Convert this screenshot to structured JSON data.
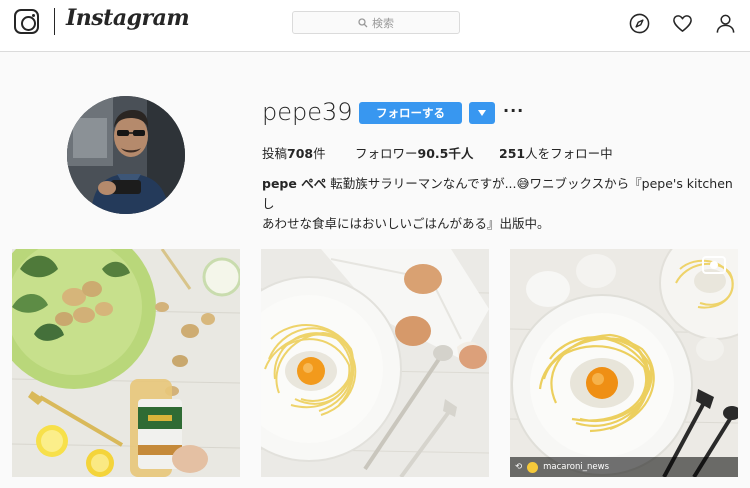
{
  "header": {
    "wordmark": "Instagram",
    "search_placeholder": "検索",
    "icons": [
      "instagram-logo-icon",
      "search-icon",
      "compass-icon",
      "heart-icon",
      "person-icon"
    ]
  },
  "profile": {
    "username": "pepe39",
    "follow_label": "フォローする",
    "more_label": "···",
    "stats": {
      "posts_prefix": "投稿",
      "posts_count": "708",
      "posts_suffix": "件",
      "followers_prefix": "フォロワー",
      "followers_count": "90.5千人",
      "following_count": "251",
      "following_suffix": "人をフォロー中"
    },
    "bio": {
      "name": "pepe ぺぺ",
      "line1": "転勤族サラリーマンなんですが...😅ワニブックスから『pepe's kitchen し",
      "line2": "あわせな食卓にはおいしいごはんがある』出版中。"
    }
  },
  "posts": [
    {
      "label": "post-1"
    },
    {
      "label": "post-2"
    },
    {
      "label": "post-3",
      "credit": "macaroni_news",
      "media_icon": "video-icon"
    }
  ],
  "colors": {
    "accent": "#3897f0",
    "border": "#dbdbdb",
    "background": "#fafafa"
  }
}
